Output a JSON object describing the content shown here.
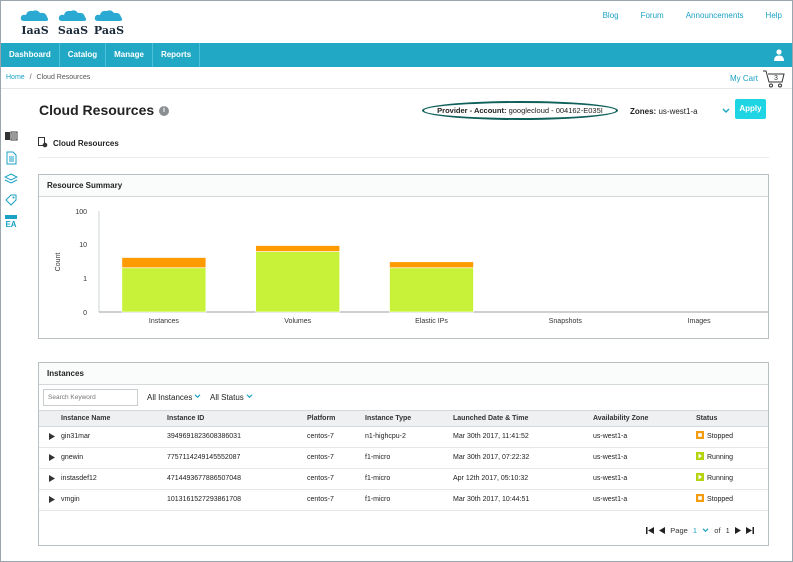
{
  "logos": [
    {
      "text": "IaaS"
    },
    {
      "text": "SaaS"
    },
    {
      "text": "PaaS"
    }
  ],
  "top_links": [
    "Blog",
    "Forum",
    "Announcements",
    "Help"
  ],
  "nav": [
    "Dashboard",
    "Catalog",
    "Manage",
    "Reports"
  ],
  "breadcrumb": {
    "home": "Home",
    "sep": "/",
    "current": "Cloud Resources"
  },
  "cart": {
    "label": "My Cart",
    "count": "3"
  },
  "page": {
    "title": "Cloud Resources",
    "info_glyph": "i",
    "provider_label": "Provider - Account:",
    "provider_value": "googlecloud - 004162-E035I",
    "zones_label": "Zones:",
    "zones_value": "us-west1-a",
    "apply": "Apply",
    "subtitle": "Cloud Resources"
  },
  "summary": {
    "title": "Resource Summary"
  },
  "chart_data": {
    "type": "bar",
    "ylabel": "Count",
    "yscale": "log",
    "yticks": [
      "100",
      "10",
      "1",
      "0"
    ],
    "categories": [
      "Instances",
      "Volumes",
      "Elastic IPs",
      "Snapshots",
      "Images"
    ],
    "series": [
      {
        "values": [
          2,
          6,
          2,
          0,
          0
        ],
        "color": "#c8f23a"
      },
      {
        "values": [
          2,
          3,
          1,
          0,
          0
        ],
        "color": "#ff9a00"
      }
    ]
  },
  "instances": {
    "title": "Instances",
    "search_placeholder": "Search Keyword",
    "filter_instances": "All Instances",
    "filter_status": "All Status",
    "columns": [
      "Instance Name",
      "Instance ID",
      "Platform",
      "Instance Type",
      "Launched Date & Time",
      "Availability Zone",
      "Status"
    ],
    "rows": [
      {
        "name": "gin31mar",
        "id": "3949691823608386031",
        "platform": "centos-7",
        "type": "n1-highcpu-2",
        "launched": "Mar 30th 2017, 11:41:52",
        "zone": "us-west1-a",
        "status": "Stopped",
        "status_color": "#f39c12"
      },
      {
        "name": "gnewin",
        "id": "7757114249145552087",
        "platform": "centos-7",
        "type": "f1-micro",
        "launched": "Mar 30th 2017, 07:22:32",
        "zone": "us-west1-a",
        "status": "Running",
        "status_color": "#b5d40f"
      },
      {
        "name": "instasdef12",
        "id": "4714493677886507048",
        "platform": "centos-7",
        "type": "f1-micro",
        "launched": "Apr 12th 2017, 05:10:32",
        "zone": "us-west1-a",
        "status": "Running",
        "status_color": "#b5d40f"
      },
      {
        "name": "vmgin",
        "id": "1013161527293861708",
        "platform": "centos-7",
        "type": "f1-micro",
        "launched": "Mar 30th 2017, 10:44:51",
        "zone": "us-west1-a",
        "status": "Stopped",
        "status_color": "#f39c12"
      }
    ],
    "pager": {
      "label": "Page",
      "current": "1",
      "of_label": "of",
      "total": "1"
    }
  }
}
